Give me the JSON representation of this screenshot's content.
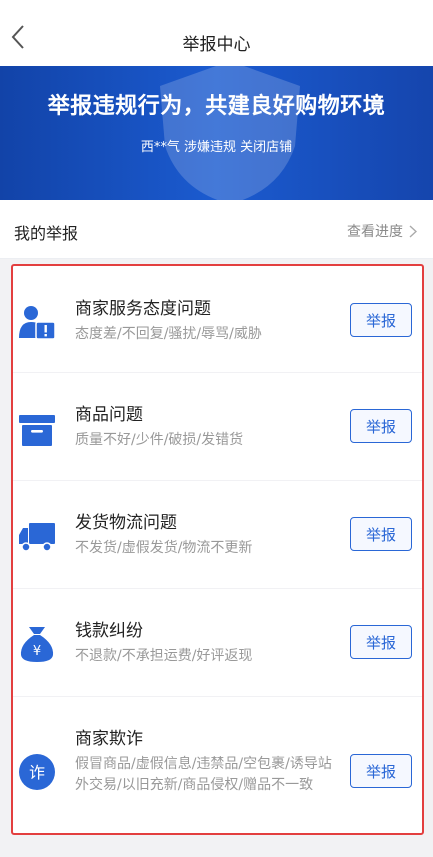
{
  "header": {
    "title": "举报中心"
  },
  "banner": {
    "headline": "举报违规行为，共建良好购物环境",
    "notice": "西**气 涉嫌违规 关闭店铺"
  },
  "my_reports": {
    "label": "我的举报",
    "progress_link": "查看进度"
  },
  "categories": [
    {
      "title": "商家服务态度问题",
      "desc": "态度差/不回复/骚扰/辱骂/威胁",
      "button": "举报",
      "icon": "merchant-warning-icon"
    },
    {
      "title": "商品问题",
      "desc": "质量不好/少件/破损/发错货",
      "button": "举报",
      "icon": "box-icon"
    },
    {
      "title": "发货物流问题",
      "desc": "不发货/虚假发货/物流不更新",
      "button": "举报",
      "icon": "truck-icon"
    },
    {
      "title": "钱款纠纷",
      "desc": "不退款/不承担运费/好评返现",
      "button": "举报",
      "icon": "money-bag-icon"
    },
    {
      "title": "商家欺诈",
      "desc": "假冒商品/虚假信息/违禁品/空包裹/诱导站外交易/以旧充新/商品侵权/赠品不一致",
      "button": "举报",
      "icon": "fraud-icon"
    }
  ],
  "colors": {
    "accent": "#2a67d6",
    "banner": "#1b5bd0",
    "highlight_border": "#e33f3f"
  }
}
